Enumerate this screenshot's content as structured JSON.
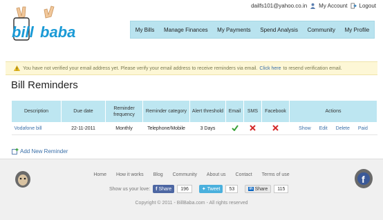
{
  "account": {
    "email": "dailfs101@yahoo.co.in",
    "my_account": "My Account",
    "logout": "Logout"
  },
  "logo": {
    "part1": "bill",
    "part2": "baba"
  },
  "nav": [
    {
      "label": "My Bills"
    },
    {
      "label": "Manage Finances"
    },
    {
      "label": "My Payments"
    },
    {
      "label": "Spend Analysis"
    },
    {
      "label": "Community"
    },
    {
      "label": "My Profile"
    }
  ],
  "alert": {
    "text_before": "You have not verified your email address yet. Please verify your email address to receive reminders via email.",
    "link": "Click here",
    "text_after": "to resend verification email."
  },
  "page_title": "Bill Reminders",
  "table": {
    "headers": {
      "description": "Description",
      "due_date": "Due date",
      "frequency": "Reminder frequency",
      "category": "Reminder category",
      "threshold": "Alert threshold",
      "email": "Email",
      "sms": "SMS",
      "facebook": "Facebook",
      "actions": "Actions"
    },
    "rows": [
      {
        "description": "Vodafone bill",
        "due_date": "22-11-2011",
        "frequency": "Monthly",
        "category": "Telephone/Mobile",
        "threshold": "3 Days",
        "email": "enabled",
        "sms": "disabled",
        "facebook": "disabled",
        "actions": {
          "show": "Show",
          "edit": "Edit",
          "delete": "Delete",
          "paid": "Paid"
        }
      }
    ]
  },
  "add_reminder": "Add New Reminder",
  "footer": {
    "links": [
      "Home",
      "How it works",
      "Blog",
      "Community",
      "About us",
      "Contact",
      "Terms of use"
    ],
    "share_label": "Show us your love:",
    "facebook": {
      "label": "Share",
      "count": "196"
    },
    "twitter": {
      "label": "Tweet",
      "count": "53"
    },
    "linkedin": {
      "label": "Share",
      "count": "115"
    },
    "copyright": "Copyright © 2011 - BillBaba.com - All rights reserved"
  },
  "colors": {
    "nav_bg": "#b9e3ef",
    "table_header_bg": "#bde6f1",
    "link": "#3a6fa8",
    "alert_bg": "#fdf7d6",
    "check_green": "#3aa23a",
    "cross_red": "#d42a2a"
  }
}
